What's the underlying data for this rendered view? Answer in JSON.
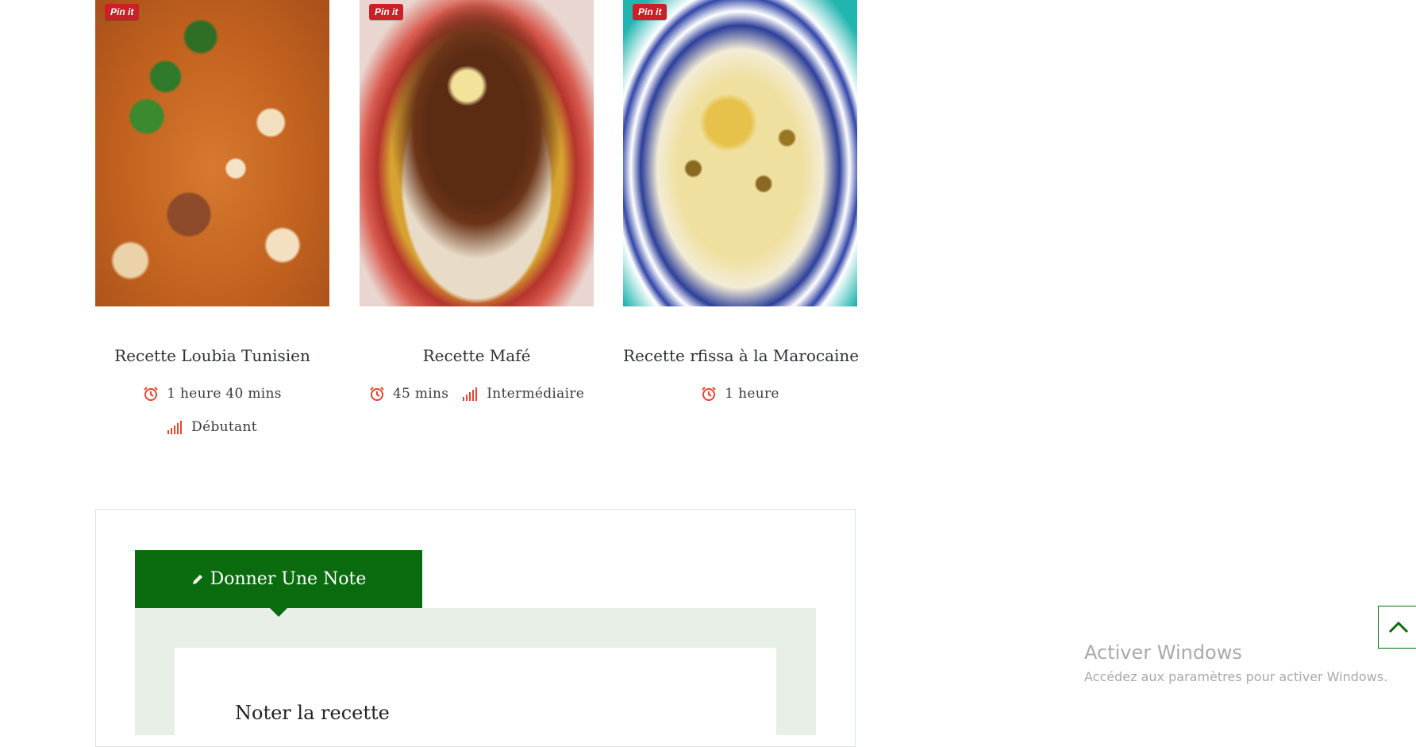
{
  "pin_label": "Pin it",
  "recipes": [
    {
      "title": "Recette Loubia Tunisien",
      "time": "1 heure 40 mins",
      "level": "Débutant",
      "image": "loubia-photo"
    },
    {
      "title": "Recette Mafé",
      "time": "45 mins",
      "level": "Intermédiaire",
      "image": "mafe-photo"
    },
    {
      "title": "Recette rfissa à la Marocaine",
      "time": "1 heure",
      "level": "",
      "image": "rfissa-photo"
    }
  ],
  "rating": {
    "tab_label": "Donner Une Note",
    "panel_title": "Noter la recette"
  },
  "watermark": {
    "title": "Activer Windows",
    "subtitle": "Accédez aux paramètres pour activer Windows."
  },
  "colors": {
    "accent_green": "#0a6b0f",
    "icon_red": "#e8442e",
    "pin_red": "#cb2027",
    "panel_bg": "#e7efe6"
  },
  "icons": {
    "time": "alarm-clock-icon",
    "level": "signal-bars-icon",
    "tab": "pencil-icon",
    "scroll": "chevron-up-icon"
  }
}
